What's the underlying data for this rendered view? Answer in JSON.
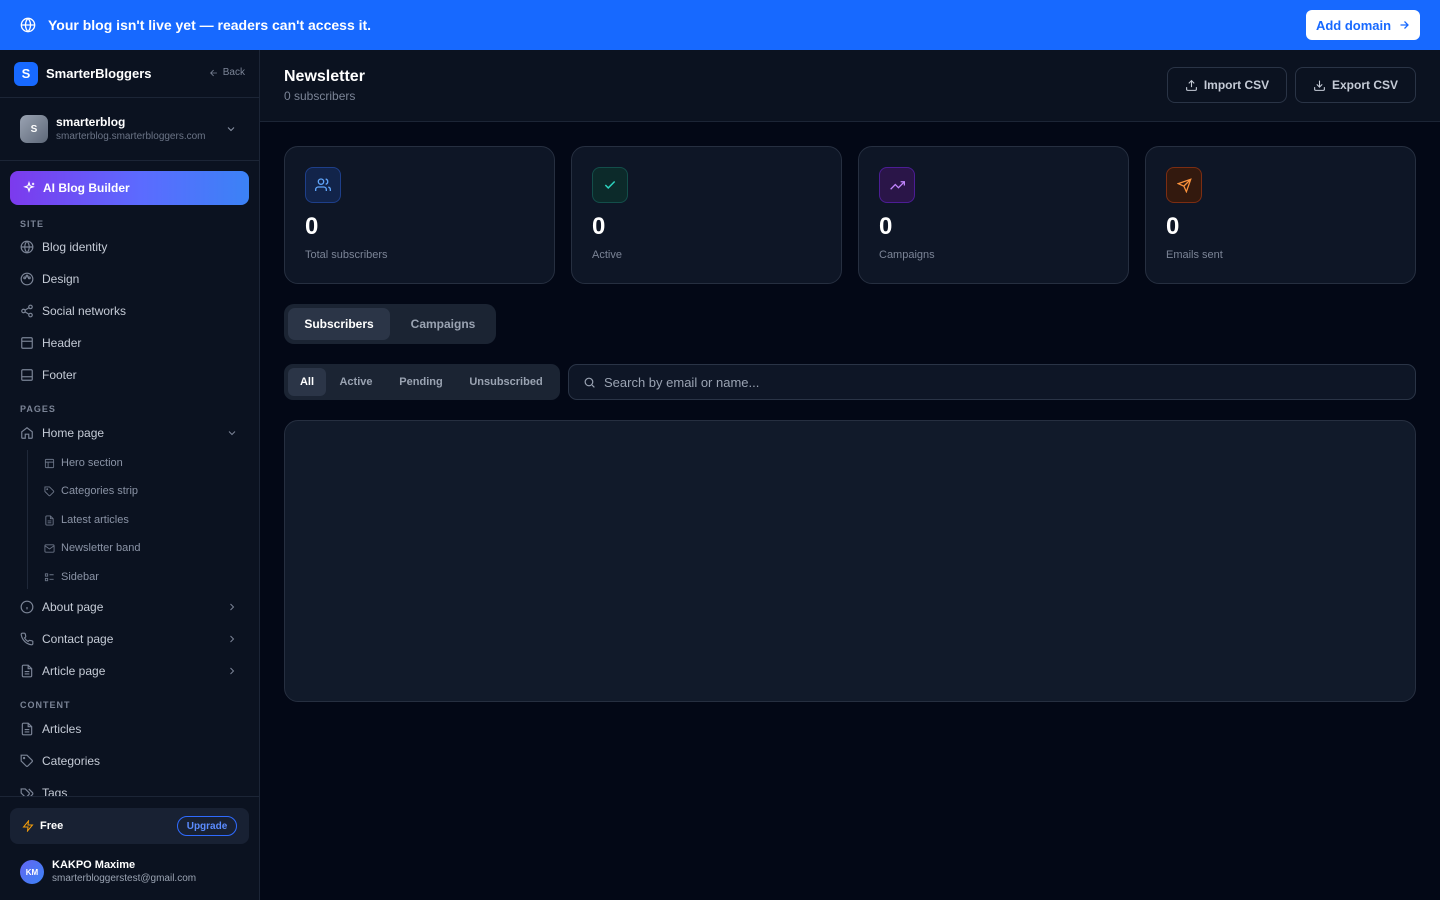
{
  "banner": {
    "message": "Your blog isn't live yet — readers can't access it.",
    "button": "Add domain"
  },
  "brand": {
    "logo_letter": "S",
    "name": "SmarterBloggers",
    "back": "Back"
  },
  "site": {
    "avatar": "S",
    "name": "smarterblog",
    "url": "smarterblog.smarterbloggers.com"
  },
  "ai_button": "AI Blog Builder",
  "sections": {
    "site": "SITE",
    "pages": "PAGES",
    "content": "CONTENT"
  },
  "nav_site": [
    {
      "label": "Blog identity",
      "icon": "globe-icon"
    },
    {
      "label": "Design",
      "icon": "palette-icon"
    },
    {
      "label": "Social networks",
      "icon": "share-icon"
    },
    {
      "label": "Header",
      "icon": "header-layout-icon"
    },
    {
      "label": "Footer",
      "icon": "footer-layout-icon"
    }
  ],
  "nav_pages": {
    "home": "Home page",
    "home_sub": [
      {
        "label": "Hero section",
        "icon": "layout-icon"
      },
      {
        "label": "Categories strip",
        "icon": "tag-icon"
      },
      {
        "label": "Latest articles",
        "icon": "file-icon"
      },
      {
        "label": "Newsletter band",
        "icon": "mail-icon"
      },
      {
        "label": "Sidebar",
        "icon": "list-icon"
      }
    ],
    "about": "About page",
    "contact": "Contact page",
    "article": "Article page"
  },
  "nav_content": [
    {
      "label": "Articles",
      "icon": "file-icon"
    },
    {
      "label": "Categories",
      "icon": "tag-icon"
    },
    {
      "label": "Tags",
      "icon": "tags-icon"
    }
  ],
  "plan": {
    "name": "Free",
    "upgrade": "Upgrade"
  },
  "user": {
    "initials": "KM",
    "name": "KAKPO Maxime",
    "email": "smarterbloggerstest@gmail.com"
  },
  "header": {
    "title": "Newsletter",
    "subtitle": "0 subscribers",
    "import": "Import CSV",
    "export": "Export CSV"
  },
  "stats": [
    {
      "value": "0",
      "label": "Total subscribers",
      "icon": "users-icon",
      "color": "#3b82f6"
    },
    {
      "value": "0",
      "label": "Active",
      "icon": "check-icon",
      "color": "#14b8a6"
    },
    {
      "value": "0",
      "label": "Campaigns",
      "icon": "trending-up-icon",
      "color": "#a855f7"
    },
    {
      "value": "0",
      "label": "Emails sent",
      "icon": "send-icon",
      "color": "#f97316"
    }
  ],
  "tabs": [
    "Subscribers",
    "Campaigns"
  ],
  "filters": [
    "All",
    "Active",
    "Pending",
    "Unsubscribed"
  ],
  "search": {
    "placeholder": "Search by email or name..."
  },
  "colors": {
    "accent": "#1769ff",
    "background": "#030816",
    "sidebar": "#0b1220"
  }
}
